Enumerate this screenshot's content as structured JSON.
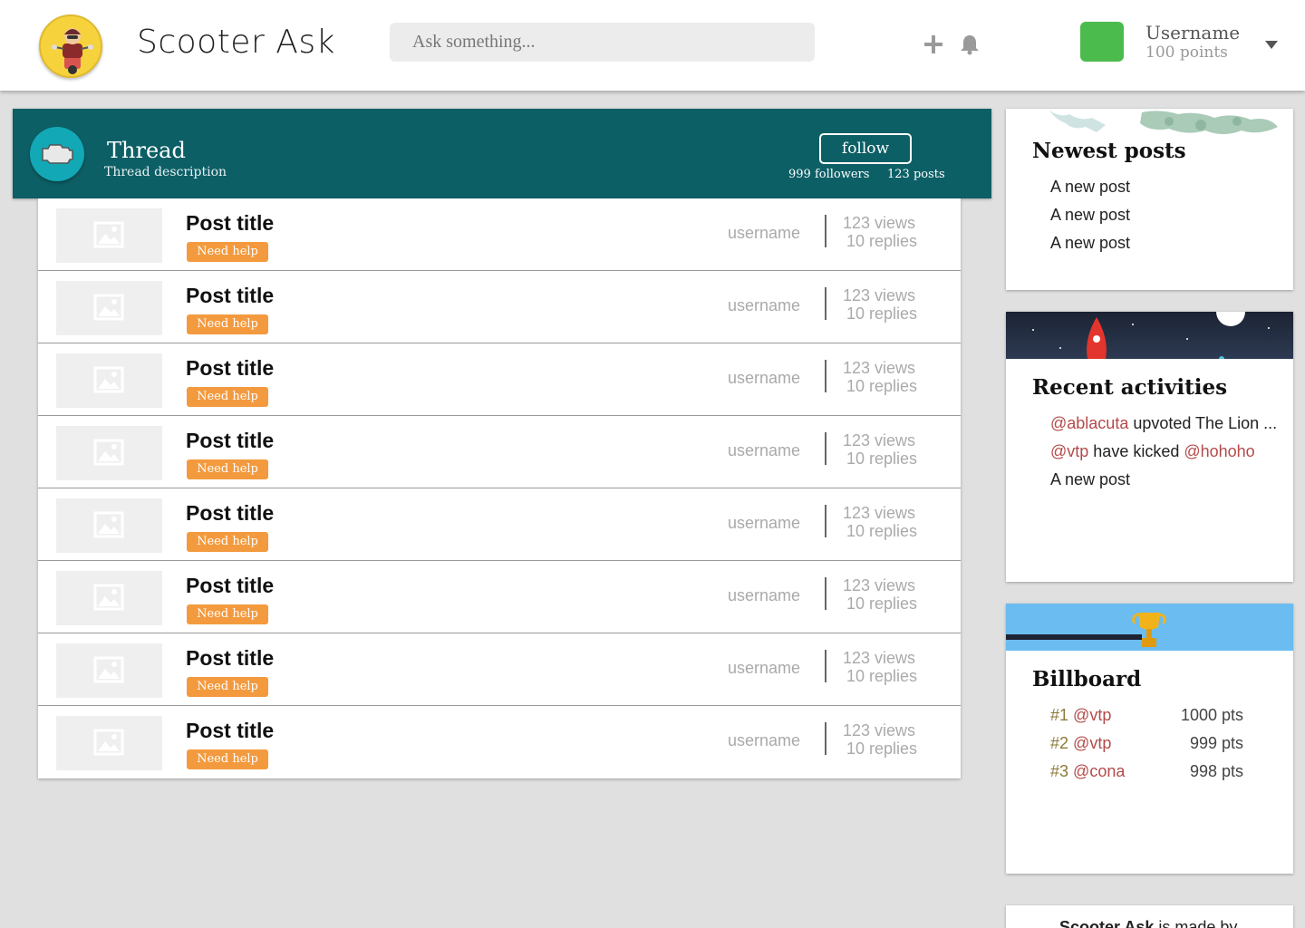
{
  "header": {
    "app_title": "Scooter Ask",
    "search_placeholder": "Ask something...",
    "icons": [
      "plus-icon",
      "bell-icon",
      "chevron-down-icon"
    ],
    "user": {
      "name": "Username",
      "points": "100 points",
      "avatar_color": "#4cbb4e"
    }
  },
  "thread": {
    "title": "Thread",
    "description": "Thread description",
    "follow_label": "follow",
    "followers": "999 followers",
    "posts": "123 posts",
    "bar_color": "#0d5f66"
  },
  "posts": [
    {
      "title": "Post title",
      "tag": "Need help",
      "username": "username",
      "views": "123 views",
      "replies": "10 replies"
    },
    {
      "title": "Post title",
      "tag": "Need help",
      "username": "username",
      "views": "123 views",
      "replies": "10 replies"
    },
    {
      "title": "Post title",
      "tag": "Need help",
      "username": "username",
      "views": "123 views",
      "replies": "10 replies"
    },
    {
      "title": "Post title",
      "tag": "Need help",
      "username": "username",
      "views": "123 views",
      "replies": "10 replies"
    },
    {
      "title": "Post title",
      "tag": "Need help",
      "username": "username",
      "views": "123 views",
      "replies": "10 replies"
    },
    {
      "title": "Post title",
      "tag": "Need help",
      "username": "username",
      "views": "123 views",
      "replies": "10 replies"
    },
    {
      "title": "Post title",
      "tag": "Need help",
      "username": "username",
      "views": "123 views",
      "replies": "10 replies"
    },
    {
      "title": "Post title",
      "tag": "Need help",
      "username": "username",
      "views": "123 views",
      "replies": "10 replies"
    }
  ],
  "sidebar": {
    "newest": {
      "title": "Newest posts",
      "items": [
        "A new post",
        "A new post",
        "A new post"
      ]
    },
    "activity": {
      "title": "Recent activities",
      "items": [
        {
          "mention": "@ablacuta",
          "text": " upvoted The Lion ...",
          "mention2": ""
        },
        {
          "mention": "@vtp",
          "text": " have kicked ",
          "mention2": "@hohoho"
        },
        {
          "mention": "",
          "text": "A new post",
          "mention2": ""
        }
      ]
    },
    "billboard": {
      "title": "Billboard",
      "rows": [
        {
          "rank": "#1",
          "user": "@vtp",
          "points": "1000 pts"
        },
        {
          "rank": "#2",
          "user": "@vtp",
          "points": "999 pts"
        },
        {
          "rank": "#3",
          "user": "@cona",
          "points": "998 pts"
        }
      ]
    },
    "footer": {
      "brand": "Scooter Ask",
      "text": " is made by"
    }
  },
  "colors": {
    "tag": "#f39a3e",
    "mention": "#b44a4a",
    "rank": "#8c7a3a"
  }
}
